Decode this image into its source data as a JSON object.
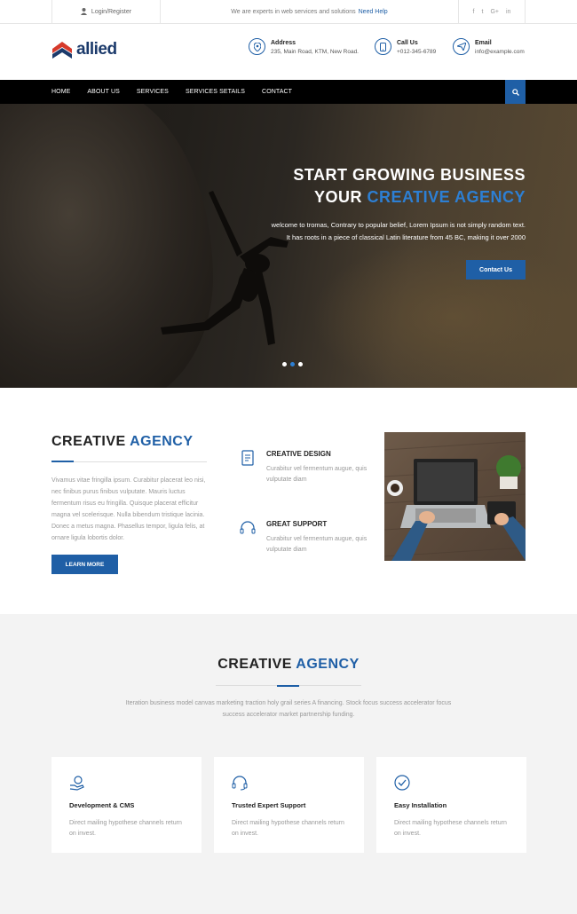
{
  "topbar": {
    "login_label": "Login/Register",
    "message": "We are experts in web services and solutions",
    "message_link": "Need Help",
    "social": [
      "f",
      "t",
      "G+",
      "in"
    ]
  },
  "header": {
    "logo_text": "allied",
    "address": {
      "label": "Address",
      "value": "235, Main Road, KTM, New Road."
    },
    "call": {
      "label": "Call Us",
      "value": "+012-345-6789"
    },
    "email": {
      "label": "Email",
      "value": "info@example.com"
    }
  },
  "nav": {
    "items": [
      "HOME",
      "ABOUT US",
      "SERVICES",
      "SERVICES SETAILS",
      "CONTACT"
    ]
  },
  "hero": {
    "title_line1": "START GROWING BUSINESS",
    "title_line2_a": "YOUR ",
    "title_line2_b": "CREATIVE AGENCY",
    "text_line1": "welcome to tromas, Contrary to popular belief, Lorem Ipsum is not simply random text.",
    "text_line2": "It has roots in a piece of classical Latin literature from 45 BC, making it over 2000",
    "button": "Contact Us",
    "slides_active_index": 1
  },
  "about": {
    "title_a": "CREATIVE ",
    "title_b": "AGENCY",
    "description": "Vivamus vitae fringilla ipsum. Curabitur placerat leo nisi, nec finibus purus finibus vulputate. Mauris luctus fermentum risus eu fringilla. Quisque placerat efficitur magna vel scelerisque. Nulla bibendum tristique lacinia. Donec a metus magna. Phasellus tempor, ligula felis, at ornare ligula lobortis dolor.",
    "button": "LEARN MORE",
    "features": [
      {
        "title": "CREATIVE DESIGN",
        "text": "Curabitur vel fermentum augue, quis vulputate diam"
      },
      {
        "title": "GREAT SUPPORT",
        "text": "Curabitur vel fermentum augue, quis vulputate diam"
      }
    ]
  },
  "services": {
    "title_a": "CREATIVE ",
    "title_b": "AGENCY",
    "description": "Iteration business model canvas marketing traction holy grail series A financing. Stock focus success accelerator focus success accelerator market partnership funding.",
    "cards": [
      {
        "title": "Development & CMS",
        "text": "Direct mailing hypothese channels return on invest.",
        "icon": "hand-icon"
      },
      {
        "title": "Trusted Expert Support",
        "text": "Direct mailing hypothese channels return on invest.",
        "icon": "headset-icon"
      },
      {
        "title": "Easy Installation",
        "text": "Direct mailing hypothese channels return on invest.",
        "icon": "check-circle-icon"
      }
    ]
  },
  "colors": {
    "accent": "#1f5fa6",
    "accent_light": "#2d7fd3",
    "logo_red": "#d63a2b",
    "nav_bg": "#000000"
  }
}
